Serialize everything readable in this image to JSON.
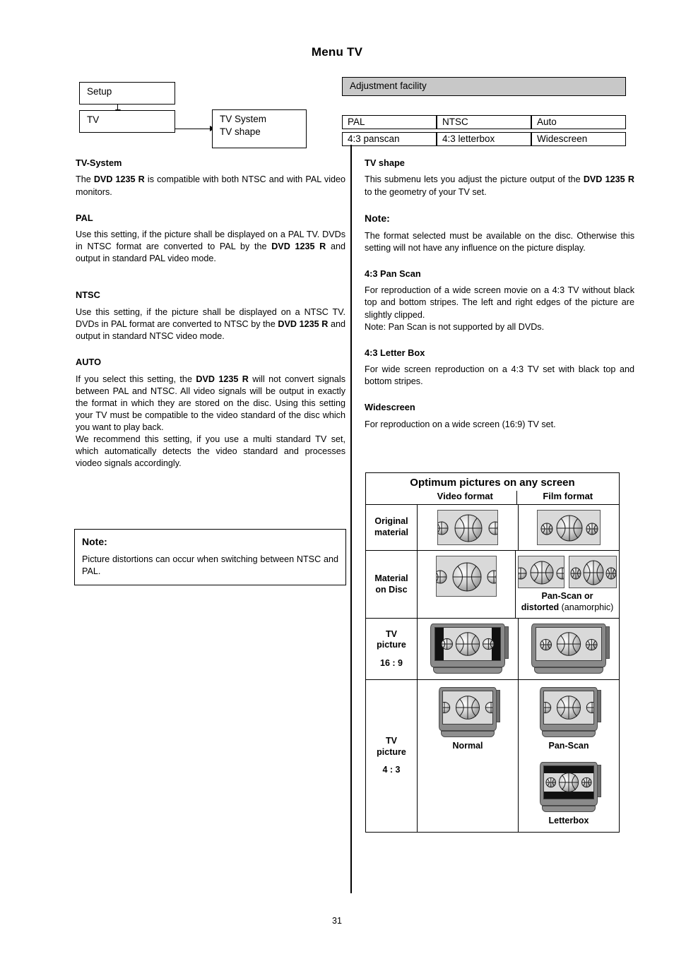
{
  "page": {
    "title": "Menu TV",
    "number": "31"
  },
  "flow": {
    "setup": "Setup",
    "tv": "TV",
    "submenu_line1": "TV System",
    "submenu_line2": "TV shape"
  },
  "adjustment": {
    "bar_label": "Adjustment facility",
    "columns": [
      {
        "top": "PAL",
        "bottom": "4:3 panscan"
      },
      {
        "top": "NTSC",
        "bottom": "4:3 letterbox"
      },
      {
        "top": "Auto",
        "bottom": "Widescreen"
      }
    ]
  },
  "left_column": {
    "tv_system_heading": "TV-System",
    "tv_system_body_1": "The ",
    "tv_system_body_bold": "DVD 1235 R",
    "tv_system_body_2": " is compatible with both NTSC and with PAL video monitors.",
    "pal_heading": "PAL",
    "pal_body_1": "Use this setting, if the picture shall be displayed on a PAL TV. DVDs in NTSC format are converted to PAL by the ",
    "pal_body_bold": "DVD 1235 R",
    "pal_body_2": " and output in standard PAL video mode.",
    "ntsc_heading": "NTSC",
    "ntsc_body_1": "Use this setting, if the picture shall be displayed on a NTSC TV. DVDs in PAL format are converted to NTSC by the ",
    "ntsc_body_bold": "DVD 1235 R",
    "ntsc_body_2": " and output in standard NTSC video mode.",
    "auto_heading": "AUTO",
    "auto_body_1": "If you select this setting, the ",
    "auto_body_bold": "DVD 1235 R",
    "auto_body_2": " will not convert signals between PAL and NTSC. All video signals will be output in exactly the format in which they are stored on the disc. Using this setting your TV must be compatible to the video standard of the disc which you want to play back.",
    "auto_body_3": "We recommend this setting, if you use a multi standard TV set, which automatically detects the video standard and processes viodeo signals accordingly.",
    "note_heading": "Note:",
    "note_body": "Picture distortions can occur when switching between NTSC and PAL."
  },
  "right_column": {
    "tv_shape_heading": "TV shape",
    "tv_shape_body_1": "This submenu lets you adjust the picture output of the ",
    "tv_shape_body_bold": "DVD 1235 R",
    "tv_shape_body_2": " to the geometry of your TV set.",
    "note_heading": "Note:",
    "note_body": "The format selected must be available on the disc. Otherwise this setting will not have any influence on the picture display.",
    "panscan_heading": "4:3 Pan Scan",
    "panscan_body": "For reproduction of a wide screen movie on a 4:3 TV without black top and bottom stripes. The left and right edges of the picture are slightly clipped.",
    "panscan_note": "Note: Pan Scan is not supported by all DVDs.",
    "letterbox_heading": "4:3 Letter Box",
    "letterbox_body": "For wide screen reproduction on a 4:3 TV set with black top and bottom stripes.",
    "widescreen_heading": "Widescreen",
    "widescreen_body": "For reproduction on a wide screen (16:9) TV set."
  },
  "optimum_table": {
    "title": "Optimum pictures on any screen",
    "col_video": "Video format",
    "col_film": "Film format",
    "rows": [
      {
        "label_line1": "Original",
        "label_line2": "material",
        "ratio": ""
      },
      {
        "label_line1": "Material",
        "label_line2": "on Disc",
        "ratio": ""
      },
      {
        "label_line1": "TV",
        "label_line2": "picture",
        "ratio": "16 : 9"
      },
      {
        "label_line1": "TV",
        "label_line2": "picture",
        "ratio": "4 : 3"
      }
    ],
    "captions": {
      "panscan_or_distorted_bold": "Pan-Scan or",
      "distorted_bold": "distorted",
      "anamorphic_light": " (anamorphic)",
      "normal": "Normal",
      "panscan": "Pan-Scan",
      "letterbox": "Letterbox"
    }
  },
  "colors": {
    "adjustment_bar_fill": "#c8c8c8",
    "picture_fill": "#d9d9d9",
    "tv_cabinet": "#8a8a8a",
    "black_bars": "#111111"
  }
}
